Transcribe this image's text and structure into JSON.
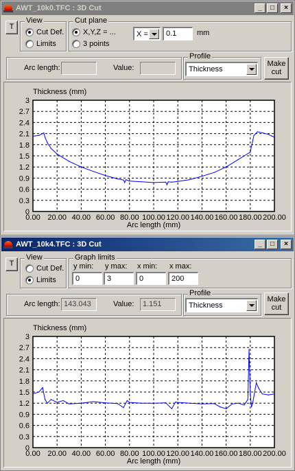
{
  "window1": {
    "title": "AWT_10k0.TFC : 3D Cut",
    "controls": {
      "minimize": "_",
      "maximize": "□",
      "close": "×"
    },
    "t_button": "T",
    "view": {
      "label": "View",
      "options": [
        "Cut Def.",
        "Limits"
      ],
      "selected": "Cut Def."
    },
    "cut_plane": {
      "label": "Cut plane",
      "options": [
        "X,Y,Z = ...",
        "3 points"
      ],
      "selected": "X,Y,Z = ...",
      "axis": "X =",
      "value": "0.1",
      "unit": "mm"
    },
    "arc_length_label": "Arc length:",
    "arc_length_value": "",
    "value_label": "Value:",
    "value_value": "",
    "profile": {
      "label": "Profile",
      "selected": "Thickness"
    },
    "make_cut": {
      "line1": "Make",
      "line2": "cut"
    }
  },
  "window2": {
    "title": "AWT_10k4.TFC : 3D Cut",
    "controls": {
      "minimize": "_",
      "maximize": "□",
      "close": "×"
    },
    "t_button": "T",
    "view": {
      "label": "View",
      "options": [
        "Cut Def.",
        "Limits"
      ],
      "selected": "Limits"
    },
    "graph_limits": {
      "label": "Graph limits",
      "y_min_label": "y min:",
      "y_min": "0",
      "y_max_label": "y max:",
      "y_max": "3",
      "x_min_label": "x min:",
      "x_min": "0",
      "x_max_label": "x max:",
      "x_max": "200"
    },
    "arc_length_label": "Arc length:",
    "arc_length_value": "143.043",
    "value_label": "Value:",
    "value_value": "1.151",
    "profile": {
      "label": "Profile",
      "selected": "Thickness"
    },
    "make_cut": {
      "line1": "Make",
      "line2": "cut"
    }
  },
  "colors": {
    "series": "#0000ff",
    "grid": "#000000",
    "active_title": "#0a246a",
    "inactive_title": "#808080"
  },
  "chart_data": [
    {
      "type": "line",
      "ylabel": "Thickness (mm)",
      "xlabel": "Arc length (mm)",
      "xlim": [
        0,
        200
      ],
      "ylim": [
        0,
        3
      ],
      "x_ticks": [
        "0.00",
        "20.00",
        "40.00",
        "60.00",
        "80.00",
        "100.00",
        "120.00",
        "140.00",
        "160.00",
        "180.00",
        "200.00"
      ],
      "y_ticks": [
        "0",
        "0.3",
        "0.6",
        "0.9",
        "1.2",
        "1.5",
        "1.8",
        "2.1",
        "2.4",
        "2.7",
        "3"
      ],
      "grid": true,
      "series": [
        {
          "x": [
            0,
            5,
            9,
            10,
            12,
            15,
            20,
            30,
            40,
            50,
            60,
            70,
            75,
            76,
            77,
            80,
            90,
            100,
            110,
            111,
            112,
            115,
            120,
            130,
            140,
            150,
            160,
            170,
            175,
            180,
            183,
            186,
            190,
            195,
            200
          ],
          "y": [
            2.03,
            2.05,
            2.12,
            2.0,
            1.85,
            1.7,
            1.55,
            1.35,
            1.2,
            1.08,
            0.97,
            0.88,
            0.85,
            0.78,
            0.86,
            0.82,
            0.8,
            0.78,
            0.79,
            0.72,
            0.8,
            0.79,
            0.81,
            0.86,
            0.95,
            1.05,
            1.2,
            1.4,
            1.5,
            1.6,
            2.05,
            2.15,
            2.12,
            2.08,
            2.0
          ]
        }
      ]
    },
    {
      "type": "line",
      "ylabel": "Thickness (mm)",
      "xlabel": "Arc length (mm)",
      "xlim": [
        0,
        200
      ],
      "ylim": [
        0,
        3
      ],
      "x_ticks": [
        "0.00",
        "20.00",
        "40.00",
        "60.00",
        "80.00",
        "100.00",
        "120.00",
        "140.00",
        "160.00",
        "180.00",
        "200.00"
      ],
      "y_ticks": [
        "0",
        "0.3",
        "0.6",
        "0.9",
        "1.2",
        "1.5",
        "1.8",
        "2.1",
        "2.4",
        "2.7",
        "3"
      ],
      "grid": true,
      "series": [
        {
          "x": [
            0,
            5,
            8,
            10,
            12,
            15,
            20,
            25,
            30,
            40,
            50,
            60,
            70,
            75,
            78,
            80,
            90,
            100,
            110,
            115,
            118,
            120,
            130,
            140,
            150,
            155,
            160,
            165,
            170,
            175,
            178,
            179,
            180,
            181,
            182,
            185,
            187,
            190,
            195,
            200
          ],
          "y": [
            1.45,
            1.5,
            1.62,
            1.3,
            1.2,
            1.3,
            1.22,
            1.27,
            1.18,
            1.2,
            1.24,
            1.21,
            1.19,
            1.08,
            1.27,
            1.22,
            1.2,
            1.2,
            1.21,
            1.05,
            1.23,
            1.22,
            1.2,
            1.18,
            1.19,
            1.1,
            1.05,
            1.18,
            1.2,
            1.15,
            1.3,
            2.65,
            1.45,
            1.1,
            1.2,
            1.75,
            1.6,
            1.45,
            1.42,
            1.45
          ]
        }
      ]
    }
  ]
}
